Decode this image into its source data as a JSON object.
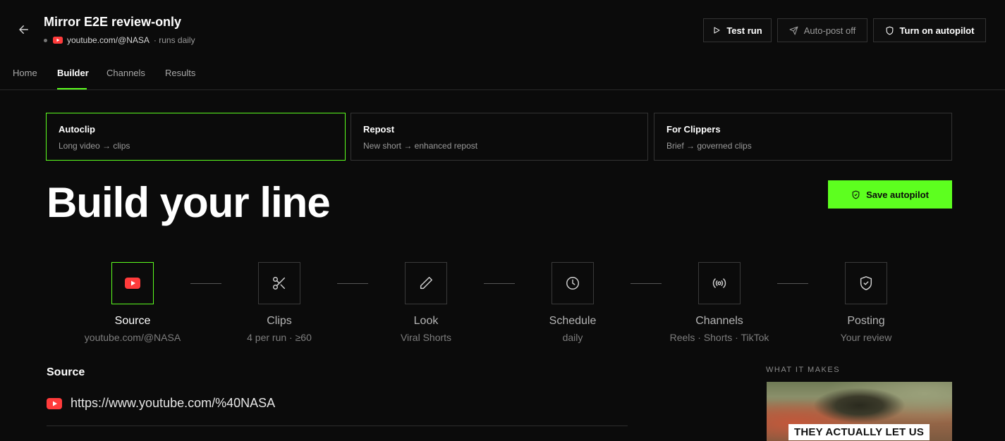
{
  "header": {
    "title": "Mirror E2E review-only",
    "source_url": "youtube.com/@NASA",
    "schedule_text": "· runs daily",
    "buttons": {
      "test_run": "Test run",
      "auto_post": "Auto-post off",
      "autopilot": "Turn on autopilot"
    }
  },
  "tabs": [
    {
      "label": "Home",
      "active": false
    },
    {
      "label": "Builder",
      "active": true
    },
    {
      "label": "Channels",
      "active": false
    },
    {
      "label": "Results",
      "active": false
    }
  ],
  "modes": [
    {
      "title": "Autoclip",
      "subtitle": "Long video → clips",
      "active": true
    },
    {
      "title": "Repost",
      "subtitle": "New short → enhanced repost",
      "active": false
    },
    {
      "title": "For Clippers",
      "subtitle": "Brief → governed clips",
      "active": false
    }
  ],
  "hero": {
    "title": "Build your line",
    "save_label": "Save autopilot"
  },
  "steps": [
    {
      "label": "Source",
      "sub": "youtube.com/@NASA",
      "icon": "youtube-icon",
      "active": true
    },
    {
      "label": "Clips",
      "sub": "4 per run · ≥60",
      "icon": "scissors-icon",
      "active": false
    },
    {
      "label": "Look",
      "sub": "Viral Shorts",
      "icon": "pencil-icon",
      "active": false
    },
    {
      "label": "Schedule",
      "sub": "daily",
      "icon": "clock-icon",
      "active": false
    },
    {
      "label": "Channels",
      "sub": "Reels · Shorts · TikTok",
      "icon": "broadcast-icon",
      "active": false
    },
    {
      "label": "Posting",
      "sub": "Your review",
      "icon": "shield-check-icon",
      "active": false
    }
  ],
  "source_section": {
    "title": "Source",
    "url": "https://www.youtube.com/%40NASA"
  },
  "preview": {
    "label": "WHAT IT MAKES",
    "caption": "THEY ACTUALLY LET US"
  },
  "colors": {
    "accent": "#5dff1f",
    "youtube_red": "#ff3b3b",
    "background": "#0b0b0b"
  }
}
